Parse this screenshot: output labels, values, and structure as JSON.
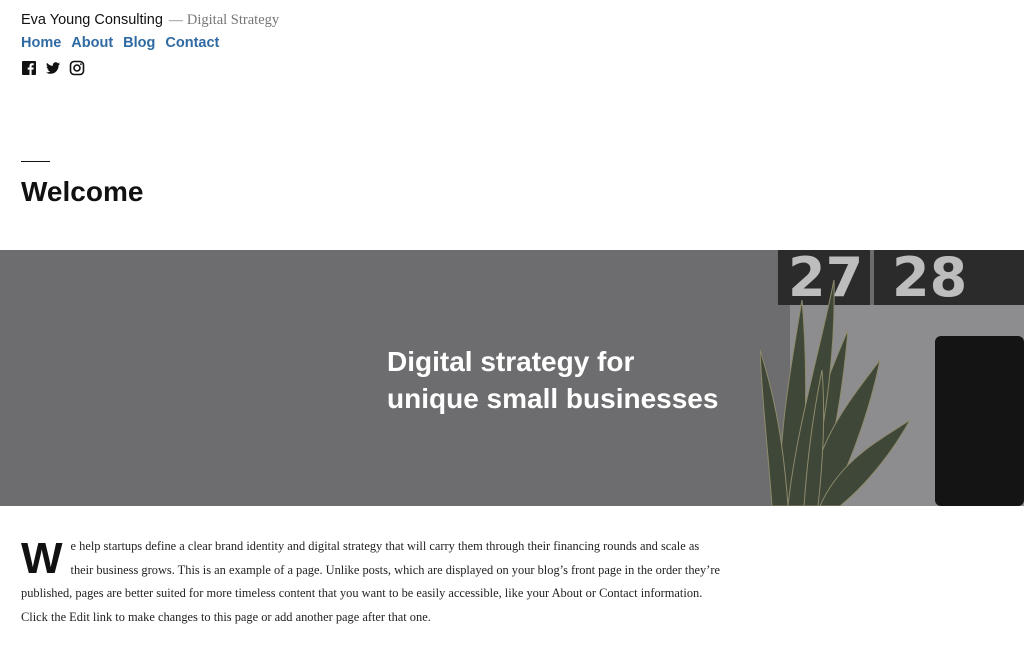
{
  "site": {
    "title": "Eva Young Consulting",
    "dash": "—",
    "description": "Digital Strategy"
  },
  "nav": [
    "Home",
    "About",
    "Blog",
    "Contact"
  ],
  "social": [
    "facebook-icon",
    "twitter-icon",
    "instagram-icon"
  ],
  "page": {
    "title": "Welcome"
  },
  "hero": {
    "line1": "Digital strategy for",
    "line2": "unique small businesses",
    "clock_left": "27",
    "clock_right": "28"
  },
  "content": {
    "dropcap": "W",
    "text": "e help startups define a clear brand identity and digital strategy that will carry them through their financing rounds and scale as their business grows. This is an example of a page. Unlike posts, which are displayed on your blog’s front page in the order they’re published, pages are better suited for more timeless content that you want to be easily accessible, like your About or Contact information. Click the Edit link to make changes to this page or add another page after that one."
  },
  "colors": {
    "link": "#2f6aa3",
    "hero_overlay": "#6d6d70",
    "text": "#111111"
  }
}
